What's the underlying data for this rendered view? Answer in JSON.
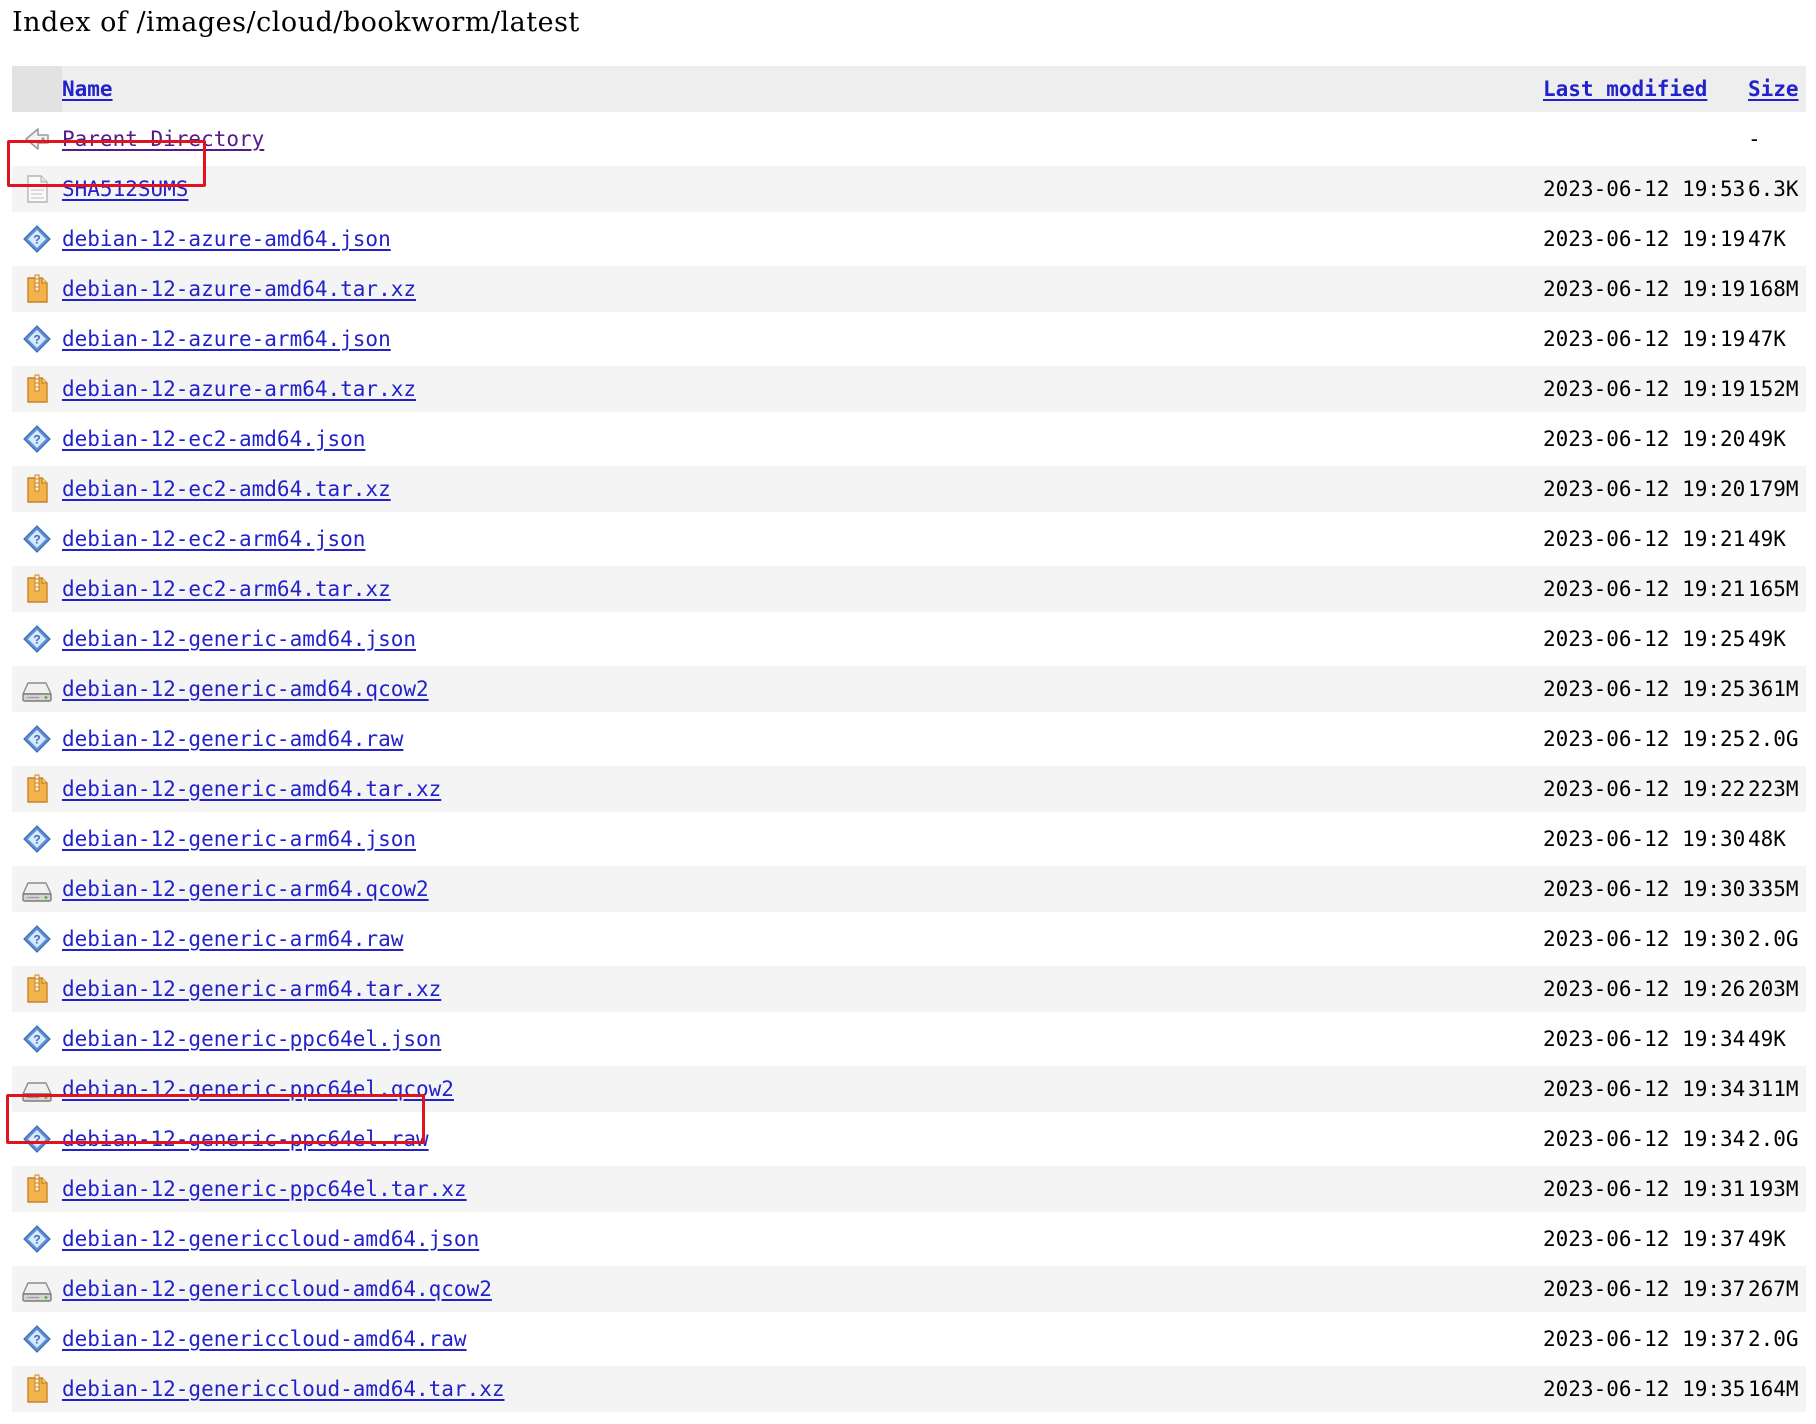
{
  "page": {
    "title": "Index of /images/cloud/bookworm/latest"
  },
  "columns": {
    "name": "Name",
    "last_modified": "Last modified",
    "size": "Size"
  },
  "parent": {
    "label": "Parent Directory",
    "size": "-",
    "icon": "back-icon"
  },
  "files": [
    {
      "name": "SHA512SUMS",
      "modified": "2023-06-12 19:53",
      "size": "6.3K",
      "icon": "text-file-icon",
      "highlighted": true
    },
    {
      "name": "debian-12-azure-amd64.json",
      "modified": "2023-06-12 19:19",
      "size": "47K",
      "icon": "unknown-file-icon"
    },
    {
      "name": "debian-12-azure-amd64.tar.xz",
      "modified": "2023-06-12 19:19",
      "size": "168M",
      "icon": "archive-icon"
    },
    {
      "name": "debian-12-azure-arm64.json",
      "modified": "2023-06-12 19:19",
      "size": "47K",
      "icon": "unknown-file-icon"
    },
    {
      "name": "debian-12-azure-arm64.tar.xz",
      "modified": "2023-06-12 19:19",
      "size": "152M",
      "icon": "archive-icon"
    },
    {
      "name": "debian-12-ec2-amd64.json",
      "modified": "2023-06-12 19:20",
      "size": "49K",
      "icon": "unknown-file-icon"
    },
    {
      "name": "debian-12-ec2-amd64.tar.xz",
      "modified": "2023-06-12 19:20",
      "size": "179M",
      "icon": "archive-icon"
    },
    {
      "name": "debian-12-ec2-arm64.json",
      "modified": "2023-06-12 19:21",
      "size": "49K",
      "icon": "unknown-file-icon"
    },
    {
      "name": "debian-12-ec2-arm64.tar.xz",
      "modified": "2023-06-12 19:21",
      "size": "165M",
      "icon": "archive-icon"
    },
    {
      "name": "debian-12-generic-amd64.json",
      "modified": "2023-06-12 19:25",
      "size": "49K",
      "icon": "unknown-file-icon"
    },
    {
      "name": "debian-12-generic-amd64.qcow2",
      "modified": "2023-06-12 19:25",
      "size": "361M",
      "icon": "disk-image-icon"
    },
    {
      "name": "debian-12-generic-amd64.raw",
      "modified": "2023-06-12 19:25",
      "size": "2.0G",
      "icon": "unknown-file-icon"
    },
    {
      "name": "debian-12-generic-amd64.tar.xz",
      "modified": "2023-06-12 19:22",
      "size": "223M",
      "icon": "archive-icon"
    },
    {
      "name": "debian-12-generic-arm64.json",
      "modified": "2023-06-12 19:30",
      "size": "48K",
      "icon": "unknown-file-icon"
    },
    {
      "name": "debian-12-generic-arm64.qcow2",
      "modified": "2023-06-12 19:30",
      "size": "335M",
      "icon": "disk-image-icon"
    },
    {
      "name": "debian-12-generic-arm64.raw",
      "modified": "2023-06-12 19:30",
      "size": "2.0G",
      "icon": "unknown-file-icon"
    },
    {
      "name": "debian-12-generic-arm64.tar.xz",
      "modified": "2023-06-12 19:26",
      "size": "203M",
      "icon": "archive-icon"
    },
    {
      "name": "debian-12-generic-ppc64el.json",
      "modified": "2023-06-12 19:34",
      "size": "49K",
      "icon": "unknown-file-icon"
    },
    {
      "name": "debian-12-generic-ppc64el.qcow2",
      "modified": "2023-06-12 19:34",
      "size": "311M",
      "icon": "disk-image-icon"
    },
    {
      "name": "debian-12-generic-ppc64el.raw",
      "modified": "2023-06-12 19:34",
      "size": "2.0G",
      "icon": "unknown-file-icon"
    },
    {
      "name": "debian-12-generic-ppc64el.tar.xz",
      "modified": "2023-06-12 19:31",
      "size": "193M",
      "icon": "archive-icon"
    },
    {
      "name": "debian-12-genericcloud-amd64.json",
      "modified": "2023-06-12 19:37",
      "size": "49K",
      "icon": "unknown-file-icon"
    },
    {
      "name": "debian-12-genericcloud-amd64.qcow2",
      "modified": "2023-06-12 19:37",
      "size": "267M",
      "icon": "disk-image-icon",
      "highlighted": true
    },
    {
      "name": "debian-12-genericcloud-amd64.raw",
      "modified": "2023-06-12 19:37",
      "size": "2.0G",
      "icon": "unknown-file-icon"
    },
    {
      "name": "debian-12-genericcloud-amd64.tar.xz",
      "modified": "2023-06-12 19:35",
      "size": "164M",
      "icon": "archive-icon"
    }
  ],
  "colors": {
    "link": "#2222cc",
    "visited_link": "#551a8b",
    "header_bg": "#eeeeee",
    "zebra_bg": "#f4f4f4",
    "highlight_box": "#e0141f"
  }
}
